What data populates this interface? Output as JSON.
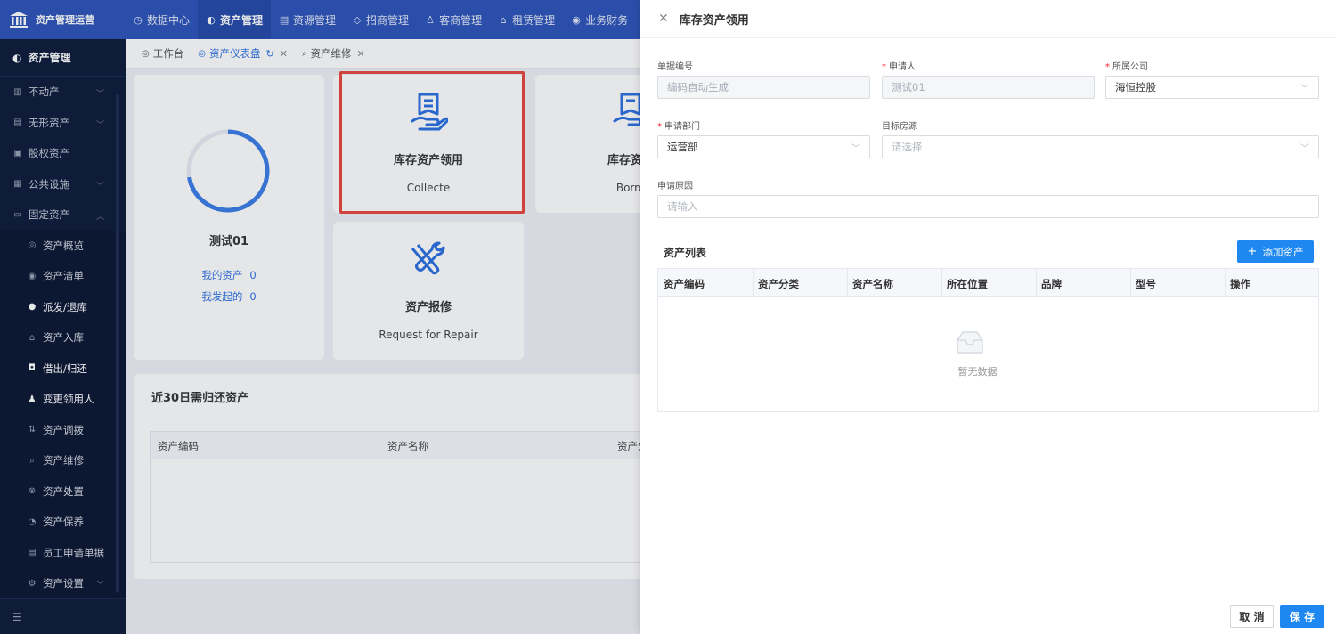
{
  "app": {
    "logo_text": "资产管理运营"
  },
  "topnav": [
    {
      "icon": "◷",
      "label": "数据中心"
    },
    {
      "icon": "◐",
      "label": "资产管理"
    },
    {
      "icon": "▤",
      "label": "资源管理"
    },
    {
      "icon": "◇",
      "label": "招商管理"
    },
    {
      "icon": "♙",
      "label": "客商管理"
    },
    {
      "icon": "⌂",
      "label": "租赁管理"
    },
    {
      "icon": "◉",
      "label": "业务财务"
    }
  ],
  "sidebar": {
    "header": "资产管理",
    "items": [
      {
        "label": "不动产"
      },
      {
        "label": "无形资产"
      },
      {
        "label": "股权资产"
      },
      {
        "label": "公共设施"
      },
      {
        "label": "固定资产"
      }
    ],
    "subitems": [
      {
        "label": "资产概览"
      },
      {
        "label": "资产清单"
      },
      {
        "label": "派发/退库"
      },
      {
        "label": "资产入库"
      },
      {
        "label": "借出/归还"
      },
      {
        "label": "变更领用人"
      },
      {
        "label": "资产调拨"
      },
      {
        "label": "资产维修"
      },
      {
        "label": "资产处置"
      },
      {
        "label": "资产保养"
      },
      {
        "label": "员工申请单据"
      },
      {
        "label": "资产设置"
      }
    ]
  },
  "tabs": [
    {
      "label": "工作台"
    },
    {
      "label": "资产仪表盘"
    },
    {
      "label": "资产维修"
    }
  ],
  "user_card": {
    "name": "测试01",
    "my_assets_label": "我的资产",
    "my_assets_count": "0",
    "initiated_label": "我发起的",
    "initiated_count": "0"
  },
  "actions": [
    {
      "title": "库存资产领用",
      "subtitle": "Collecte"
    },
    {
      "title": "库存资产",
      "subtitle": "Borro"
    },
    {
      "title": "资产报修",
      "subtitle": "Request for Repair"
    }
  ],
  "due_section": {
    "title": "近30日需归还资产",
    "columns": [
      "资产编码",
      "资产名称",
      "资产分"
    ]
  },
  "drawer": {
    "title": "库存资产领用",
    "fields": {
      "doc_no": {
        "label": "单据编号",
        "placeholder": "编码自动生成"
      },
      "applicant": {
        "label": "申请人",
        "value": "测试01"
      },
      "company": {
        "label": "所属公司",
        "value": "海恒控股"
      },
      "dept": {
        "label": "申请部门",
        "value": "运营部"
      },
      "target": {
        "label": "目标房源",
        "placeholder": "请选择"
      },
      "reason": {
        "label": "申请原因",
        "placeholder": "请输入"
      }
    },
    "asset_list_title": "资产列表",
    "add_button": "添加资产",
    "columns": [
      "资产编码",
      "资产分类",
      "资产名称",
      "所在位置",
      "品牌",
      "型号",
      "操作"
    ],
    "empty_text": "暂无数据",
    "cancel_button": "取 消",
    "save_button": "保 存"
  },
  "colors": {
    "primary": "#1e88f0",
    "nav": "#2b52b8",
    "sidebar": "#0b1a3a",
    "highlight": "#e8453c"
  }
}
